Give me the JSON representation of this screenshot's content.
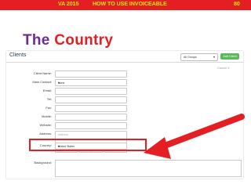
{
  "slide": {
    "header_left": "VA 2015",
    "header_title": "HOW TO USE INVOICEABLE",
    "page_number": "80",
    "title_word1": "The",
    "title_word2": "Country",
    "colors": {
      "banner": "#e41f24",
      "banner_text": "#ffe600",
      "title_purple": "#6b2c91",
      "title_red": "#e41f24",
      "add_button": "#5cb85c"
    }
  },
  "app": {
    "page_title": "Clients",
    "group_select": "All Groups",
    "add_button": "Add Client",
    "cancel_label": "Cancel",
    "form": {
      "client_name_label": "Client Name:",
      "main_contact_label": "Main Contact:",
      "main_contact_value": "None",
      "email_label": "Email:",
      "tel_label": "Tel:",
      "fax_label": "Fax:",
      "mobile_label": "Mobile:",
      "website_label": "Website:",
      "address_label": "Address:",
      "address_placeholder": "Address",
      "city_placeholder": "City",
      "state_placeholder": "State/Region",
      "zip_placeholder": "Zip/Postcode",
      "country_label": "Country:",
      "country_value": "United States",
      "background_label": "Background:"
    }
  }
}
